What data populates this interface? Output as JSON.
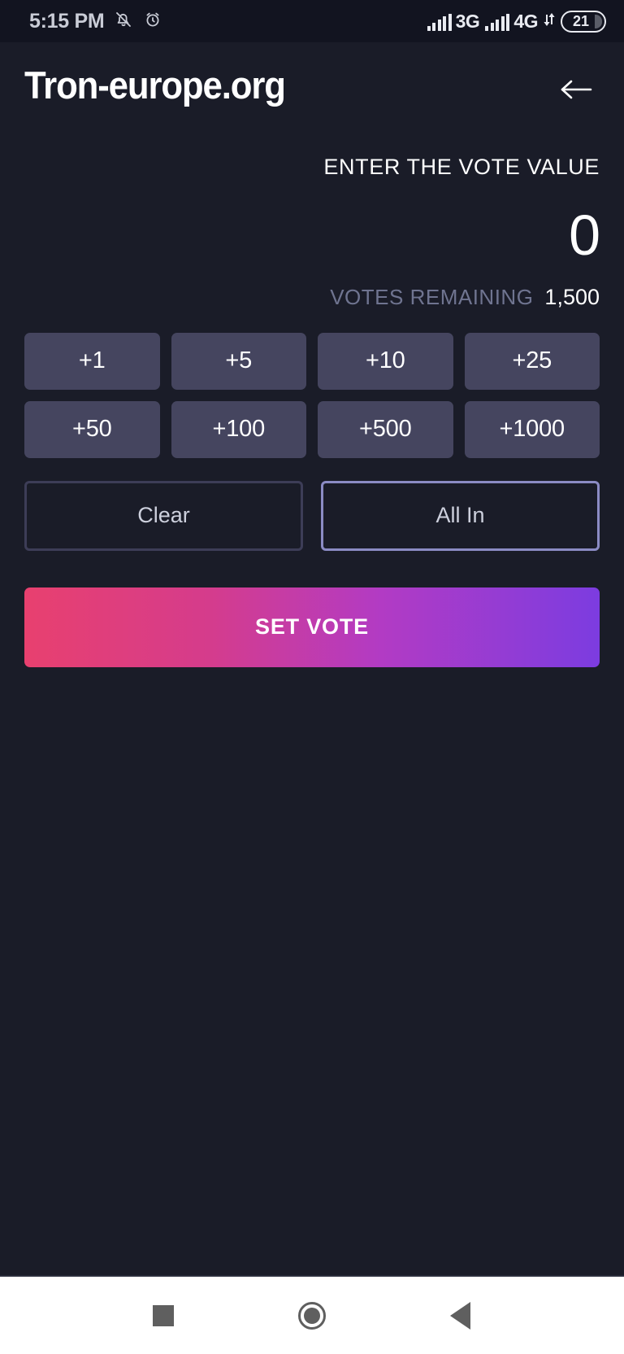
{
  "status_bar": {
    "time": "5:15 PM",
    "icons": [
      "bell-muted-icon",
      "alarm-clock-icon"
    ],
    "network_1": "3G",
    "network_2": "4G",
    "data_arrows": "⇅",
    "battery_level": "21"
  },
  "header": {
    "title": "Tron-europe.org",
    "back_icon": "arrow-left-icon"
  },
  "vote": {
    "label": "ENTER THE VOTE VALUE",
    "value": "0",
    "remaining_label": "VOTES REMAINING",
    "remaining_value": "1,500"
  },
  "quick_add": [
    {
      "label": "+1"
    },
    {
      "label": "+5"
    },
    {
      "label": "+10"
    },
    {
      "label": "+25"
    },
    {
      "label": "+50"
    },
    {
      "label": "+100"
    },
    {
      "label": "+500"
    },
    {
      "label": "+1000"
    }
  ],
  "actions": {
    "clear_label": "Clear",
    "all_in_label": "All In",
    "submit_label": "SET VOTE"
  },
  "nav_bar": {
    "recents": "square-icon",
    "home": "circle-icon",
    "back": "triangle-left-icon"
  },
  "colors": {
    "background": "#1a1c28",
    "status_bar_bg": "#121420",
    "quick_button": "#45455f",
    "muted_text": "#6f7490",
    "outline_dim": "#3d3d57",
    "outline_bright": "#8b8bc4",
    "gradient_start": "#e8406f",
    "gradient_end": "#7c3ce0"
  }
}
